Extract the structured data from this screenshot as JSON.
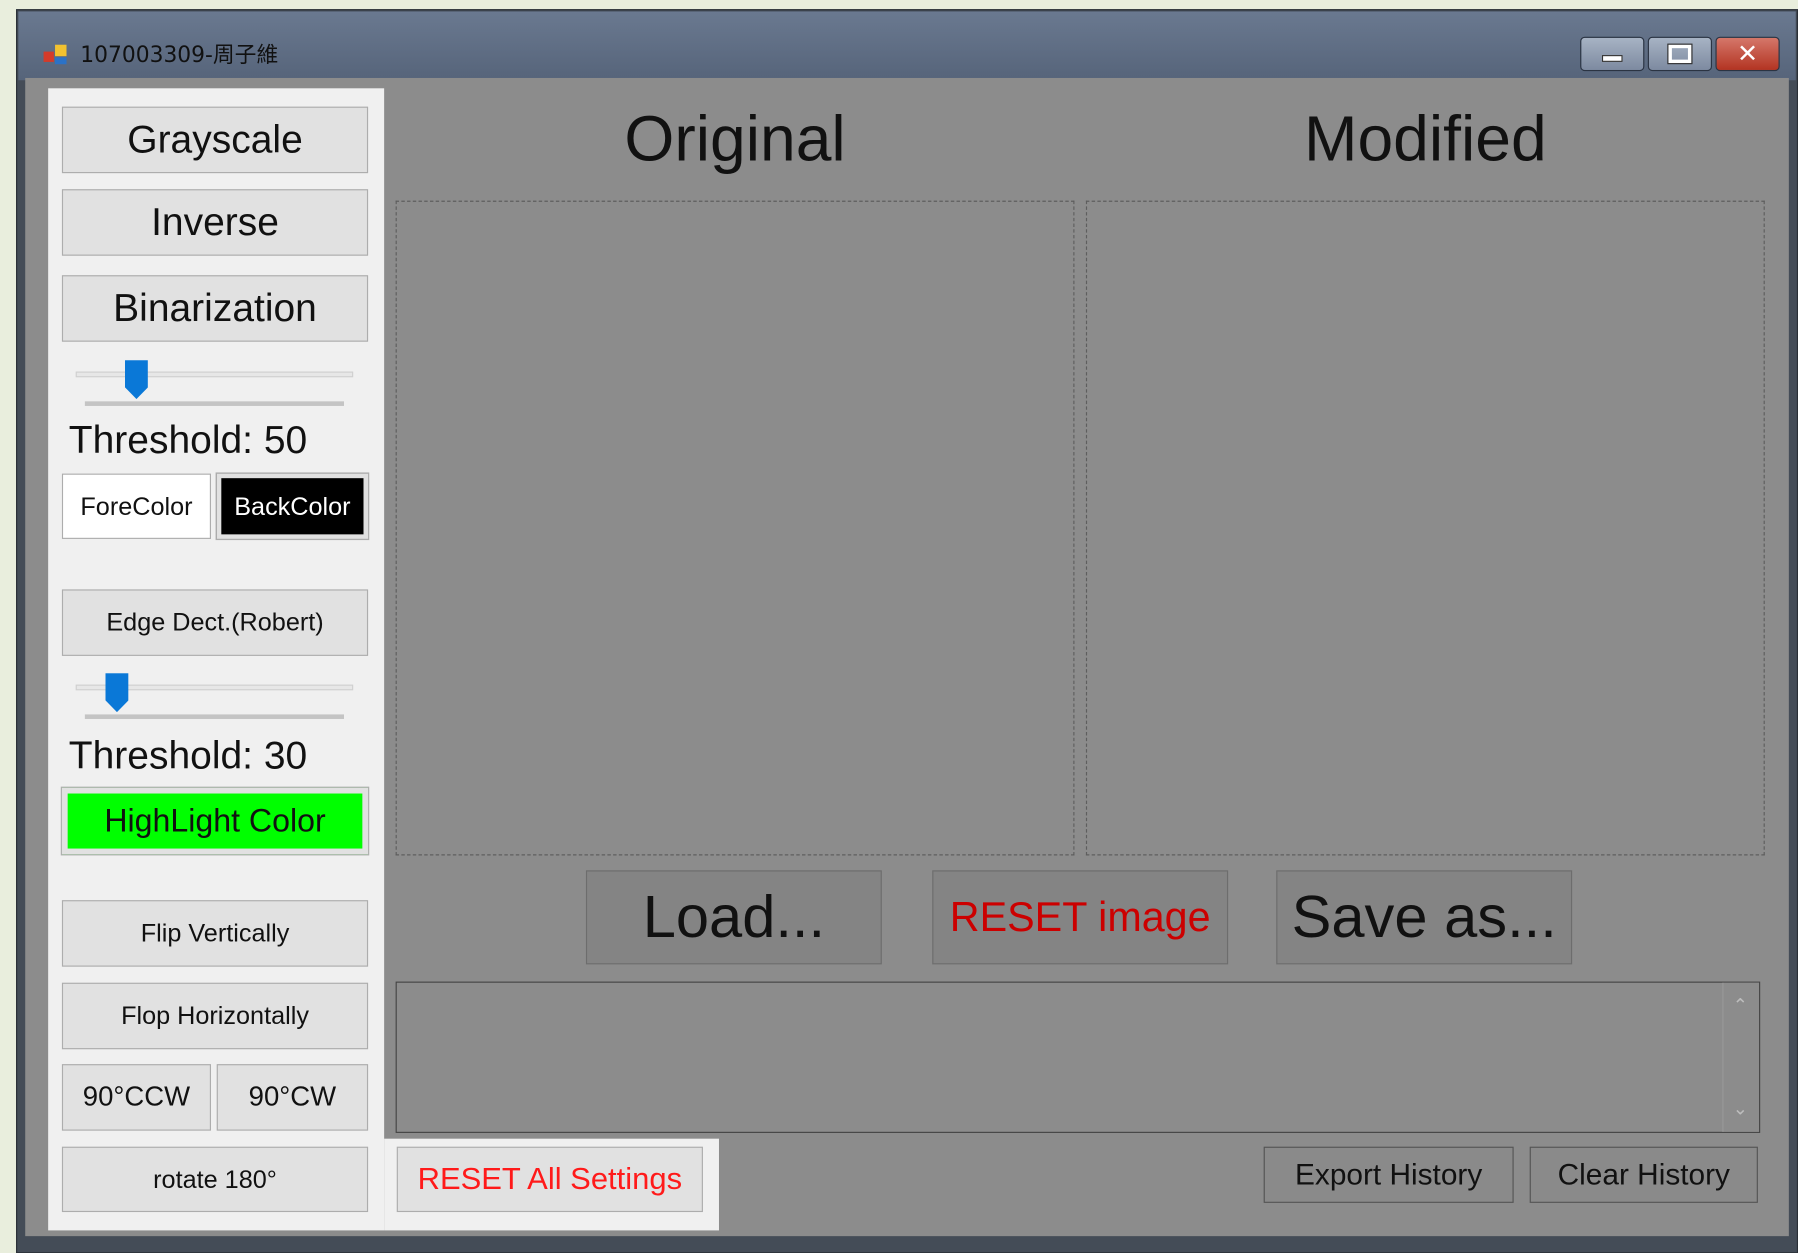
{
  "window": {
    "title": "107003309-周子維",
    "controls": {
      "minimize_icon": "minimize-icon",
      "maximize_icon": "maximize-icon",
      "close_icon": "close-icon"
    }
  },
  "sidebar": {
    "grayscale": "Grayscale",
    "inverse": "Inverse",
    "binarization": "Binarization",
    "binarization_threshold_label": "Threshold: 50",
    "binarization_threshold_value": 50,
    "forecolor": "ForeColor",
    "backcolor": "BackColor",
    "edge_detect": "Edge Dect.(Robert)",
    "edge_threshold_label": "Threshold: 30",
    "edge_threshold_value": 30,
    "highlight_color": "HighLight Color",
    "flip_vertically": "Flip Vertically",
    "flop_horizontally": "Flop Horizontally",
    "rotate_ccw": "90°CCW",
    "rotate_cw": "90°CW",
    "rotate_180": "rotate 180°",
    "reset_all": "RESET All Settings"
  },
  "main": {
    "original_heading": "Original",
    "modified_heading": "Modified",
    "load": "Load...",
    "reset_image": "RESET image",
    "save_as": "Save as...",
    "export_history": "Export History",
    "clear_history": "Clear History"
  },
  "colors": {
    "forecolor_swatch": "#ffffff",
    "backcolor_swatch": "#000000",
    "highlight_swatch": "#00ff00",
    "reset_text": "#ff1a1a",
    "reset_image_text": "#cc0000",
    "slider_thumb": "#0a78d7"
  }
}
